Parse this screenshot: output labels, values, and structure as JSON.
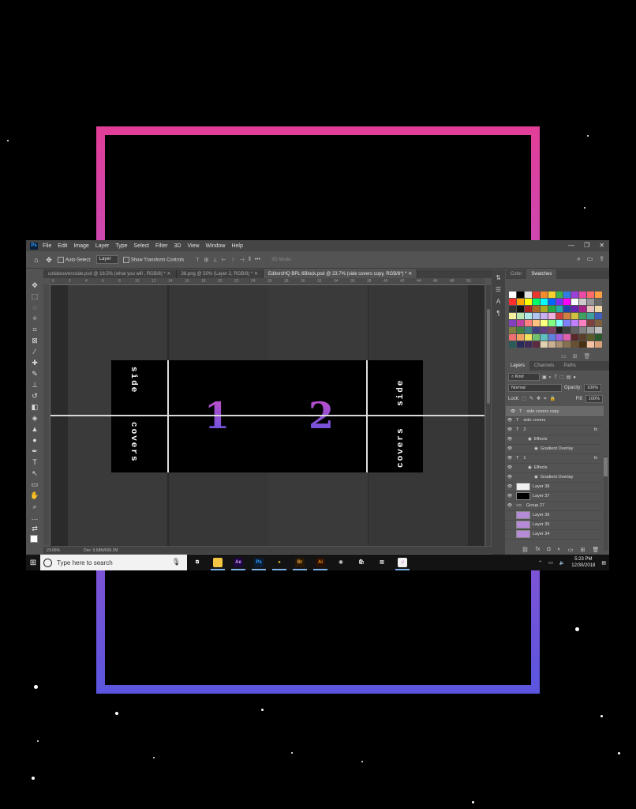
{
  "app": {
    "menus": [
      "File",
      "Edit",
      "Image",
      "Layer",
      "Type",
      "Select",
      "Filter",
      "3D",
      "View",
      "Window",
      "Help"
    ],
    "window_controls": [
      "—",
      "❐",
      "✕"
    ]
  },
  "options_bar": {
    "auto_select_label": "Auto-Select:",
    "auto_select_value": "Layer",
    "transform_label": "Show Transform Controls",
    "mode_3d": "3D Mode:"
  },
  "tabs": [
    {
      "label": "collabcoversside.psd @ 16.5% (what you will , RGB/8) *",
      "active": false
    },
    {
      "label": "38.png @ 50% (Layer 2, RGB/8) *",
      "active": false
    },
    {
      "label": "EditorsHQ BPL 6Block.psd @ 23.7% (side   covers copy, RGB/8*) *",
      "active": true
    }
  ],
  "ruler_ticks": [
    "0",
    "2",
    "4",
    "6",
    "8",
    "10",
    "12",
    "14",
    "16",
    "18",
    "20",
    "22",
    "24",
    "26",
    "28",
    "30",
    "32",
    "34",
    "36",
    "38",
    "40",
    "42",
    "44",
    "46",
    "48",
    "50"
  ],
  "canvas": {
    "left_top_text": "side",
    "left_bottom_text": "covers",
    "right_top_text": "side",
    "right_bottom_text": "covers",
    "num1": "1",
    "num2": "2"
  },
  "status": {
    "zoom": "23.66%",
    "doc": "Doc: 9.68M/696.2M"
  },
  "swatch_panel": {
    "tabs": [
      {
        "label": "Color",
        "on": false
      },
      {
        "label": "Swatches",
        "on": true
      }
    ],
    "colors": [
      "#ffffff",
      "#000000",
      "#e0e0e0",
      "#e8352e",
      "#f28b2d",
      "#f8d12d",
      "#3bb44a",
      "#2f7de0",
      "#9b3fd9",
      "#e84aa5",
      "#ff6b6b",
      "#ff9f43",
      "#ff2d2d",
      "#ffa500",
      "#ffff00",
      "#00ff66",
      "#00ffff",
      "#0066ff",
      "#7b2dff",
      "#ff00ff",
      "#ffffff",
      "#cccccc",
      "#999999",
      "#666666",
      "#333333",
      "#111111",
      "#aa2222",
      "#aa6622",
      "#aaaa22",
      "#22aa44",
      "#22aaaa",
      "#2244aa",
      "#6622aa",
      "#aa2288",
      "#e8c0c0",
      "#f0d8a8",
      "#f5f0a0",
      "#b8e8b0",
      "#b0e8e8",
      "#b0c4f0",
      "#c8b0f0",
      "#f0b0e0",
      "#d04040",
      "#d08040",
      "#d0c040",
      "#40a060",
      "#40a0a0",
      "#4060c0",
      "#8040c0",
      "#c040a0",
      "#ff8080",
      "#ffc080",
      "#ffff80",
      "#80ff80",
      "#80ffff",
      "#8080ff",
      "#c080ff",
      "#ff80c0",
      "#804040",
      "#806040",
      "#808040",
      "#408040",
      "#408080",
      "#404080",
      "#604080",
      "#804060",
      "#202020",
      "#404040",
      "#606060",
      "#808080",
      "#a0a0a0",
      "#c0c0c0",
      "#f07070",
      "#f0a060",
      "#f0e060",
      "#70c070",
      "#60c0c0",
      "#6080e0",
      "#a060e0",
      "#e060b0",
      "#5a2a2a",
      "#5a402a",
      "#5a5a2a",
      "#2a5a2a",
      "#2a5a5a",
      "#2a2a5a",
      "#402a5a",
      "#5a2a40",
      "#e0d0b0",
      "#c8b090",
      "#a89070",
      "#887050",
      "#685030",
      "#483010",
      "#f4c2a1",
      "#d9a07a"
    ]
  },
  "layers_panel": {
    "tabs": [
      {
        "label": "Layers",
        "on": true
      },
      {
        "label": "Channels",
        "on": false
      },
      {
        "label": "Paths",
        "on": false
      }
    ],
    "kind": "Kind",
    "blend": "Normal",
    "opacity_label": "Opacity:",
    "opacity": "100%",
    "lock_label": "Lock:",
    "fill_label": "Fill:",
    "fill": "100%",
    "layers": [
      {
        "name": "side   covers copy",
        "type": "T",
        "selected": true,
        "visible": true
      },
      {
        "name": "side   covers",
        "type": "T",
        "selected": false,
        "visible": true
      },
      {
        "name": "2",
        "type": "T",
        "selected": false,
        "visible": true,
        "fx": "fx"
      },
      {
        "name": "Effects",
        "type": "sub",
        "selected": false,
        "visible": true
      },
      {
        "name": "Gradient Overlay",
        "type": "sub2",
        "selected": false,
        "visible": true
      },
      {
        "name": "1",
        "type": "T",
        "selected": false,
        "visible": true,
        "fx": "fx"
      },
      {
        "name": "Effects",
        "type": "sub",
        "selected": false,
        "visible": true
      },
      {
        "name": "Gradient Overlay",
        "type": "sub2",
        "selected": false,
        "visible": true
      },
      {
        "name": "Layer 38",
        "type": "img-white",
        "selected": false,
        "visible": true
      },
      {
        "name": "Layer 37",
        "type": "img-black",
        "selected": false,
        "visible": true
      },
      {
        "name": "Group 27",
        "type": "group",
        "selected": false,
        "visible": true
      },
      {
        "name": "Layer 36",
        "type": "img-purple",
        "selected": false,
        "visible": false
      },
      {
        "name": "Layer 35",
        "type": "img-purple",
        "selected": false,
        "visible": false
      },
      {
        "name": "Layer 34",
        "type": "img-purple",
        "selected": false,
        "visible": false
      }
    ]
  },
  "taskbar": {
    "search_placeholder": "Type here to search",
    "apps": [
      {
        "name": "task-view",
        "glyph": "⧉",
        "bg": "transparent",
        "fg": "#fff",
        "active": false
      },
      {
        "name": "file-explorer",
        "glyph": "▬",
        "bg": "#f4c542",
        "fg": "#f4c542",
        "active": true
      },
      {
        "name": "after-effects",
        "glyph": "Ae",
        "bg": "#1f0740",
        "fg": "#d39bff",
        "active": true
      },
      {
        "name": "photoshop",
        "glyph": "Ps",
        "bg": "#0a1e3a",
        "fg": "#31a8ff",
        "active": true
      },
      {
        "name": "chrome",
        "glyph": "●",
        "bg": "transparent",
        "fg": "#e8b530",
        "active": true
      },
      {
        "name": "bridge",
        "glyph": "Br",
        "bg": "#2a1a05",
        "fg": "#e8a23a",
        "active": true
      },
      {
        "name": "illustrator",
        "glyph": "Ai",
        "bg": "#2a1005",
        "fg": "#ff9a00",
        "active": true
      },
      {
        "name": "obs",
        "glyph": "◉",
        "bg": "transparent",
        "fg": "#bbb",
        "active": false
      },
      {
        "name": "store",
        "glyph": "🛍",
        "bg": "transparent",
        "fg": "#fff",
        "active": false
      },
      {
        "name": "photos",
        "glyph": "▨",
        "bg": "transparent",
        "fg": "#ccc",
        "active": false
      },
      {
        "name": "itunes",
        "glyph": "♫",
        "bg": "#f2f2f2",
        "fg": "#c24ae0",
        "active": true
      }
    ],
    "time": "5:23 PM",
    "date": "12/30/2018"
  }
}
